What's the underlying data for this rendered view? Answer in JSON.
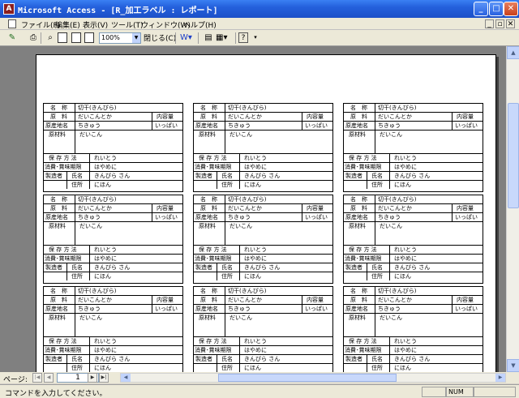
{
  "window": {
    "title": "Microsoft Access - [R_加工ラベル : レポート]",
    "min_glyph": "_",
    "max_glyph": "□",
    "close_glyph": "✕"
  },
  "menu": {
    "items": [
      "ファイル(F)",
      "編集(E)",
      "表示(V)",
      "ツール(T)",
      "ウィンドウ(W)",
      "ヘルプ(H)"
    ],
    "mdi_buttons": [
      "_",
      "▫",
      "✕"
    ]
  },
  "toolbar": {
    "icons": [
      "design-view-icon",
      "print-icon",
      "zoom-icon",
      "one-page-icon",
      "two-pages-icon",
      "multiple-pages-icon"
    ],
    "zoom_value": "100%",
    "close_label": "閉じる(C)",
    "help_label": "?"
  },
  "labels": {
    "fields": {
      "name_label": "名　称",
      "name_value": "切干(きんぴら)",
      "raw_label": "原　料",
      "raw_value": "だいこんとか",
      "volume_label": "内容量",
      "origin_label": "原産地名",
      "origin_value": "ちきゅう",
      "volume_value": "いっぱい",
      "material_label": "原材料",
      "material_value": "だいこん",
      "storage_label": "保 存 方 法",
      "storage_value": "れいとう",
      "expiry_label": "消費･賞味期限",
      "expiry_value": "はやめに",
      "maker_label": "製造者",
      "person_label": "氏名",
      "person_value": "きんぴら さん",
      "address_label": "住所",
      "address_value": "にほん"
    }
  },
  "navigation": {
    "page_label": "ページ:",
    "page_value": "1",
    "buttons": [
      "|◀",
      "◀",
      "▶",
      "▶|"
    ]
  },
  "status": {
    "message": "コマンドを入力してください。",
    "num_indicator": "NUM"
  }
}
